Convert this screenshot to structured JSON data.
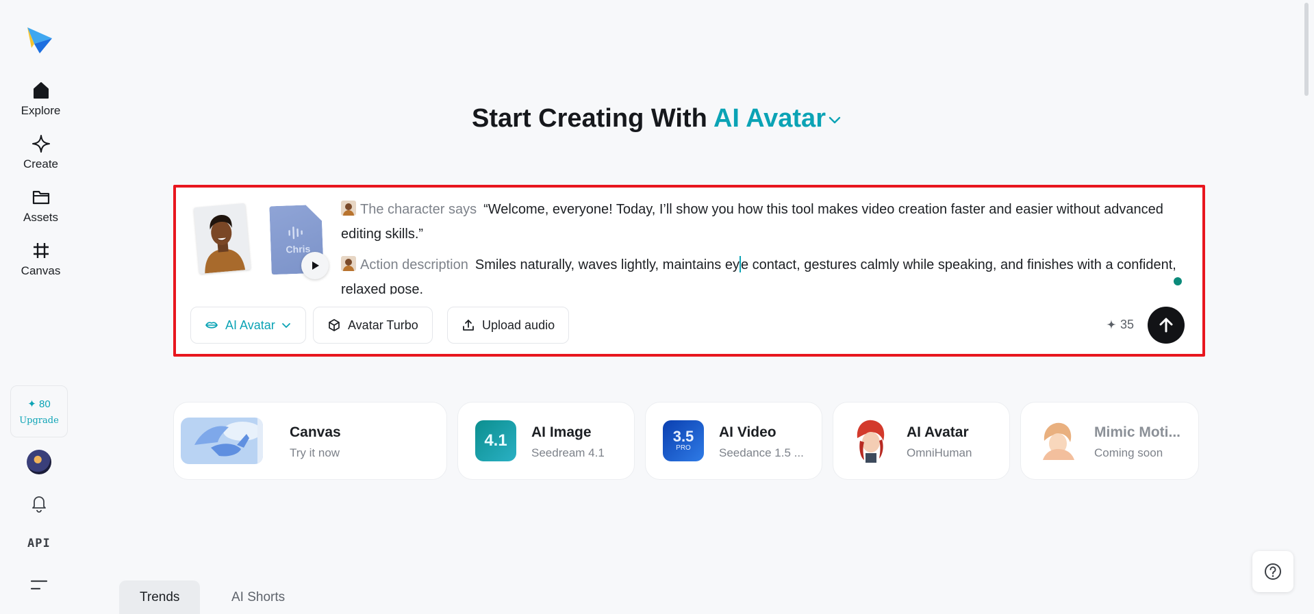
{
  "sidebar": {
    "logo_icon": "paper-plane-logo",
    "items": [
      {
        "label": "Explore",
        "icon": "home-icon"
      },
      {
        "label": "Create",
        "icon": "sparkle-icon"
      },
      {
        "label": "Assets",
        "icon": "folder-icon"
      },
      {
        "label": "Canvas",
        "icon": "canvas-grid-icon"
      }
    ],
    "credits": "✦ 80",
    "upgrade_label": "Upgrade",
    "api_label": "API"
  },
  "heading": {
    "prefix": "Start Creating With",
    "mode": "AI Avatar"
  },
  "prompt": {
    "audio_name": "Chris",
    "says_tag": "The character says",
    "says_text": "“Welcome, everyone! Today, I’ll show you how this tool makes video creation faster and easier without advanced editing skills.”",
    "action_tag": "Action description",
    "action_text_before": "Smiles naturally, waves lightly, maintains ey",
    "action_text_after": "e contact, gestures calmly while speaking, and finishes with a confident, relaxed pose.",
    "chips": {
      "model": "AI Avatar",
      "turbo": "Avatar Turbo",
      "upload": "Upload audio"
    },
    "cost": "35"
  },
  "features": [
    {
      "title": "Canvas",
      "subtitle": "Try it now"
    },
    {
      "title": "AI Image",
      "subtitle": "Seedream 4.1",
      "badge": "4.1"
    },
    {
      "title": "AI Video",
      "subtitle": "Seedance 1.5 ...",
      "badge": "3.5",
      "badge_sub": "PRO"
    },
    {
      "title": "AI Avatar",
      "subtitle": "OmniHuman"
    },
    {
      "title": "Mimic Moti...",
      "subtitle": "Coming soon"
    }
  ],
  "tabs": [
    {
      "label": "Trends",
      "active": true
    },
    {
      "label": "AI Shorts",
      "active": false
    }
  ],
  "colors": {
    "accent": "#0ba3b5",
    "highlight_border": "#e8161e",
    "send_button": "#121316"
  }
}
